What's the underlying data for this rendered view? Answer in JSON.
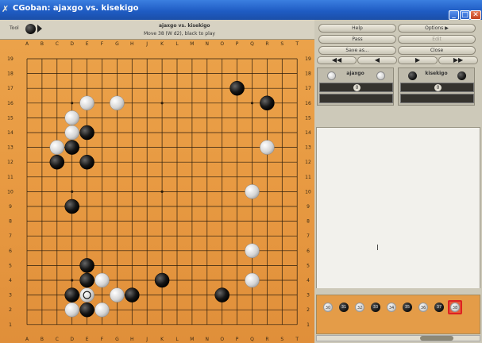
{
  "window": {
    "title": "CGoban: ajaxgo vs. kisekigo",
    "icon": "x-icon"
  },
  "board_header": {
    "tool_label": "Tool",
    "game_title": "ajaxgo vs. kisekigo",
    "move_info": "Move 38 (W d2), black to play"
  },
  "board": {
    "size": 19,
    "col_labels": [
      "A",
      "B",
      "C",
      "D",
      "E",
      "F",
      "G",
      "H",
      "J",
      "K",
      "L",
      "M",
      "N",
      "O",
      "P",
      "Q",
      "R",
      "S",
      "T"
    ],
    "row_labels": [
      "19",
      "18",
      "17",
      "16",
      "15",
      "14",
      "13",
      "12",
      "11",
      "10",
      "9",
      "8",
      "7",
      "6",
      "5",
      "4",
      "3",
      "2",
      "1"
    ],
    "stones": [
      {
        "c": "P17",
        "color": "B"
      },
      {
        "c": "R16",
        "color": "B"
      },
      {
        "c": "E16",
        "color": "W"
      },
      {
        "c": "G16",
        "color": "W"
      },
      {
        "c": "D15",
        "color": "W"
      },
      {
        "c": "D14",
        "color": "W"
      },
      {
        "c": "E14",
        "color": "B"
      },
      {
        "c": "C13",
        "color": "W"
      },
      {
        "c": "D13",
        "color": "B"
      },
      {
        "c": "C12",
        "color": "B"
      },
      {
        "c": "E12",
        "color": "B"
      },
      {
        "c": "R13",
        "color": "W"
      },
      {
        "c": "Q10",
        "color": "W"
      },
      {
        "c": "D9",
        "color": "B"
      },
      {
        "c": "Q6",
        "color": "W"
      },
      {
        "c": "Q4",
        "color": "W"
      },
      {
        "c": "E5",
        "color": "B"
      },
      {
        "c": "E4",
        "color": "B"
      },
      {
        "c": "F4",
        "color": "W"
      },
      {
        "c": "K4",
        "color": "B"
      },
      {
        "c": "D3",
        "color": "B"
      },
      {
        "c": "E3",
        "color": "W",
        "marked": true
      },
      {
        "c": "G3",
        "color": "W"
      },
      {
        "c": "H3",
        "color": "B"
      },
      {
        "c": "O3",
        "color": "B"
      },
      {
        "c": "D2",
        "color": "W"
      },
      {
        "c": "E2",
        "color": "B"
      },
      {
        "c": "F2",
        "color": "W"
      }
    ]
  },
  "controls": {
    "help": "Help",
    "options": "Options",
    "pass": "Pass",
    "edit": "Edit",
    "save_as": "Save as...",
    "close": "Close"
  },
  "players": {
    "white": {
      "name": "ajaxgo",
      "captures": "0"
    },
    "black": {
      "name": "kisekigo",
      "captures": "0"
    }
  },
  "timeline": {
    "moves": [
      {
        "n": "30",
        "color": "W"
      },
      {
        "n": "31",
        "color": "B"
      },
      {
        "n": "32",
        "color": "W"
      },
      {
        "n": "33",
        "color": "B"
      },
      {
        "n": "34",
        "color": "W"
      },
      {
        "n": "35",
        "color": "B"
      },
      {
        "n": "36",
        "color": "W"
      },
      {
        "n": "37",
        "color": "B"
      },
      {
        "n": "38",
        "color": "W"
      }
    ],
    "current": "38"
  }
}
